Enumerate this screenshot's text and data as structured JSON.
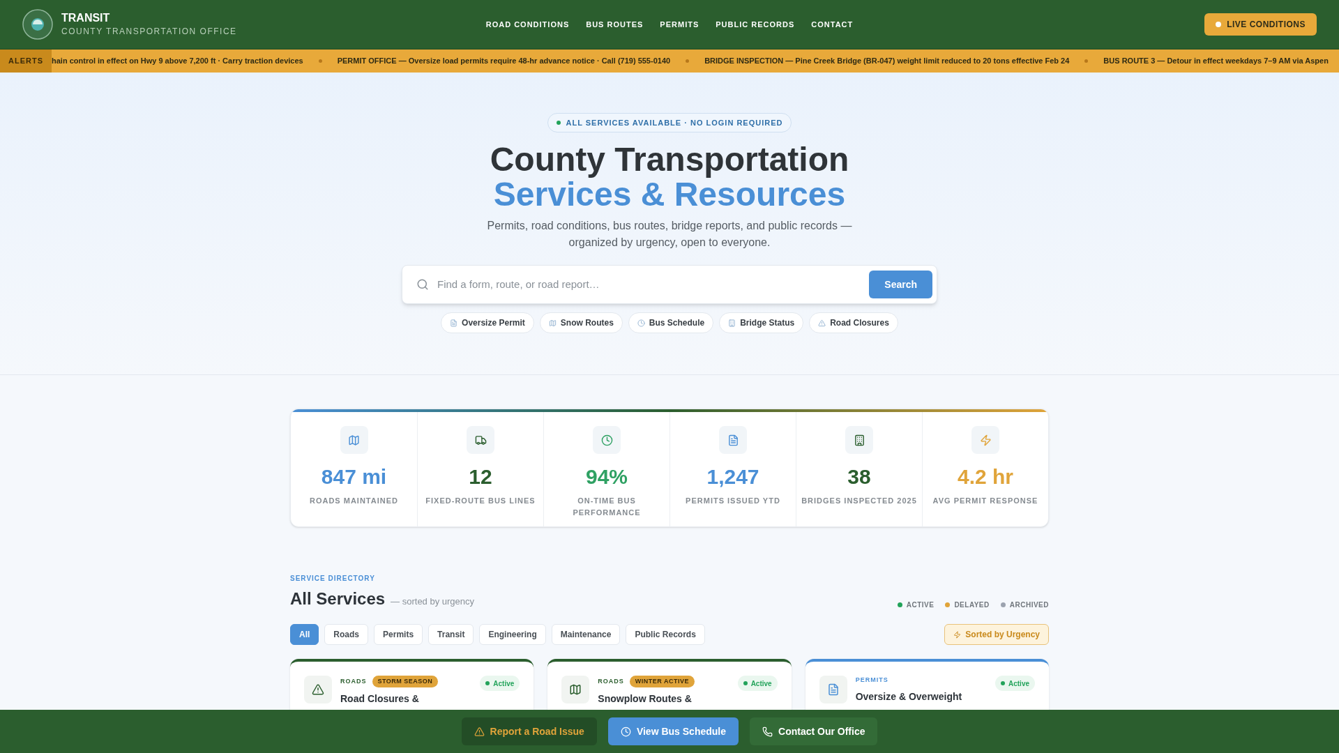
{
  "brand": {
    "name": "TRANSIT",
    "subtitle": "COUNTY TRANSPORTATION OFFICE"
  },
  "nav": [
    "ROAD CONDITIONS",
    "BUS ROUTES",
    "PERMITS",
    "PUBLIC RECORDS",
    "CONTACT"
  ],
  "live_button": "LIVE CONDITIONS",
  "alerts": {
    "label": "ALERTS",
    "items": [
      "hain control in effect on Hwy 9 above 7,200 ft · Carry traction devices",
      "PERMIT OFFICE — Oversize load permits require 48-hr advance notice · Call (719) 555-0140",
      "BRIDGE INSPECTION — Pine Creek Bridge (BR-047) weight limit reduced to 20 tons effective Feb 24",
      "BUS ROUTE 3 — Detour in effect weekdays 7–9 AM via Aspen"
    ]
  },
  "hero": {
    "badge": "ALL SERVICES AVAILABLE · NO LOGIN REQUIRED",
    "title_line_1": "County Transportation",
    "title_line_2": "Services & Resources",
    "subtitle": "Permits, road conditions, bus routes, bridge reports, and public records — organized by urgency, open to everyone.",
    "search": {
      "placeholder": "Find a form, route, or road report…",
      "button": "Search"
    },
    "quick_links": [
      {
        "kind": "document",
        "label": "Oversize Permit"
      },
      {
        "kind": "map",
        "label": "Snow Routes"
      },
      {
        "kind": "clock",
        "label": "Bus Schedule"
      },
      {
        "kind": "building",
        "label": "Bridge Status"
      },
      {
        "kind": "warning",
        "label": "Road Closures"
      }
    ]
  },
  "stats": [
    {
      "kind": "map",
      "value": "847 mi",
      "label": "ROADS MAINTAINED",
      "color": "#4a8fd6"
    },
    {
      "kind": "truck",
      "value": "12",
      "label": "FIXED-ROUTE BUS LINES",
      "color": "#2b5e2e"
    },
    {
      "kind": "clock",
      "value": "94%",
      "label": "ON-TIME BUS PERFORMANCE",
      "color": "#2fa163"
    },
    {
      "kind": "document",
      "value": "1,247",
      "label": "PERMITS ISSUED YTD",
      "color": "#4a8fd6"
    },
    {
      "kind": "building",
      "value": "38",
      "label": "BRIDGES INSPECTED 2025",
      "color": "#2b5e2e"
    },
    {
      "kind": "bolt",
      "value": "4.2 hr",
      "label": "AVG PERMIT RESPONSE",
      "color": "#e0a43a"
    }
  ],
  "directory": {
    "eyebrow": "SERVICE DIRECTORY",
    "title": "All Services",
    "note": "— sorted by urgency",
    "legend": [
      {
        "label": "ACTIVE",
        "color": "#22a35a"
      },
      {
        "label": "DELAYED",
        "color": "#e0a43a"
      },
      {
        "label": "ARCHIVED",
        "color": "#9ca3af"
      }
    ],
    "filters": [
      {
        "label": "All",
        "selected": true
      },
      {
        "label": "Roads",
        "selected": false
      },
      {
        "label": "Permits",
        "selected": false
      },
      {
        "label": "Transit",
        "selected": false
      },
      {
        "label": "Engineering",
        "selected": false
      },
      {
        "label": "Maintenance",
        "selected": false
      },
      {
        "label": "Public Records",
        "selected": false
      }
    ],
    "sort_button": "Sorted by Urgency",
    "cards": [
      {
        "kind": "warning",
        "category": "ROADS",
        "tag": "STORM SEASON",
        "status": "Active",
        "title": "Road Closures &",
        "color": "#2b5e2e"
      },
      {
        "kind": "map",
        "category": "ROADS",
        "tag": "WINTER ACTIVE",
        "status": "Active",
        "title": "Snowplow Routes &",
        "color": "#2b5e2e"
      },
      {
        "kind": "document",
        "category": "PERMITS",
        "status": "Active",
        "title": "Oversize & Overweight",
        "color": "#4a8fd6"
      }
    ]
  },
  "action_bar": [
    {
      "kind": "warning",
      "label": "Report a Road Issue"
    },
    {
      "kind": "clock",
      "label": "View Bus Schedule"
    },
    {
      "kind": "phone",
      "label": "Contact Our Office"
    }
  ]
}
